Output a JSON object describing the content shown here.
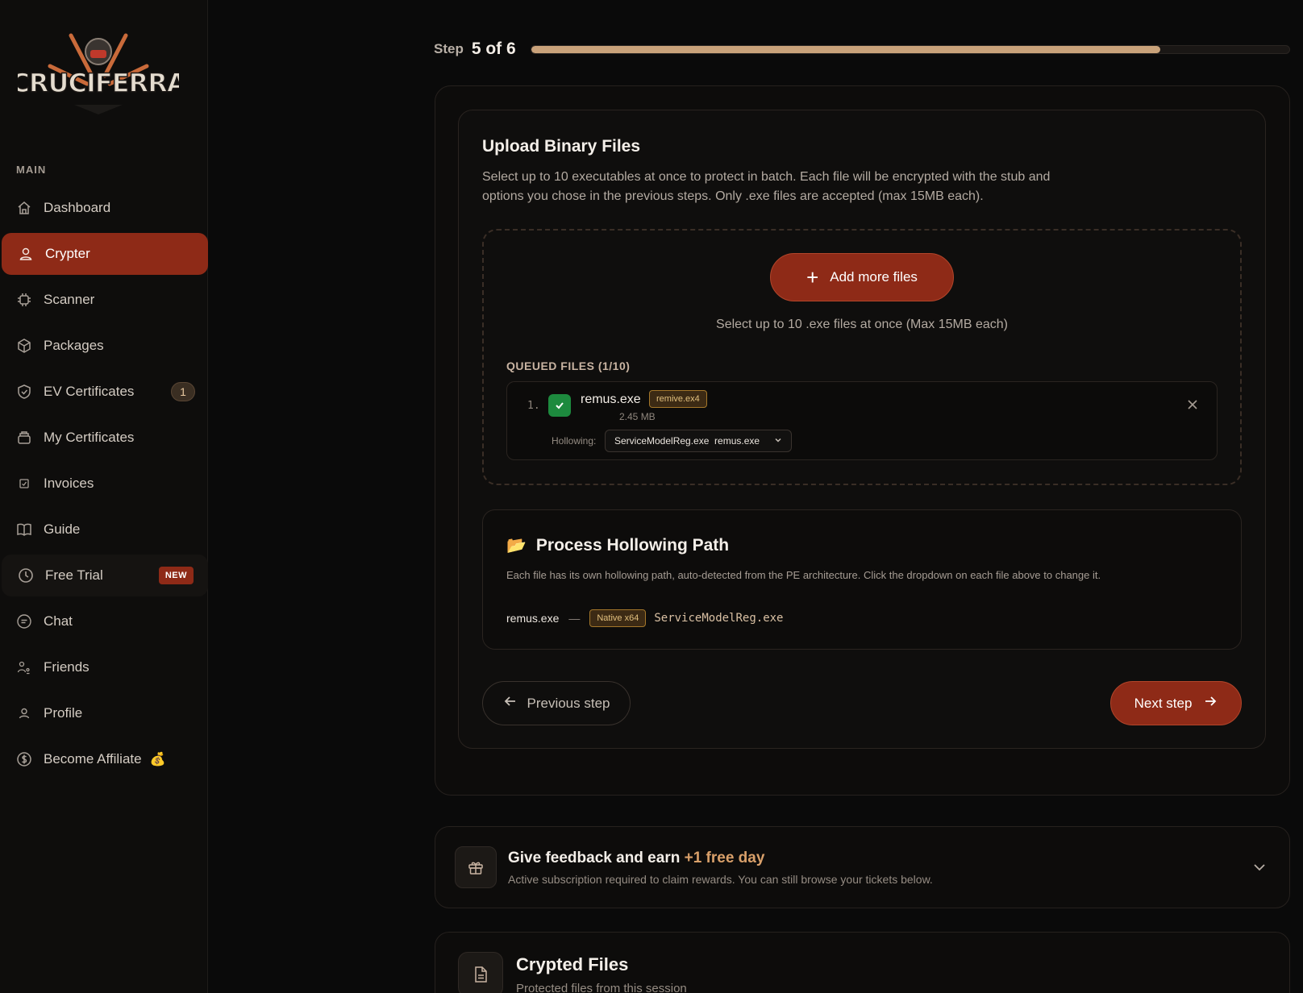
{
  "brand": {
    "logo_text": "CRUCIFERRA"
  },
  "sidebar": {
    "section_label": "MAIN",
    "items": [
      {
        "label": "Dashboard",
        "icon": "home-icon"
      },
      {
        "label": "Crypter",
        "icon": "user-icon",
        "active": true
      },
      {
        "label": "Scanner",
        "icon": "chip-icon"
      },
      {
        "label": "Packages",
        "icon": "box-icon"
      },
      {
        "label": "EV Certificates",
        "icon": "shield-icon",
        "badge": "1"
      },
      {
        "label": "My Certificates",
        "icon": "stack-icon"
      },
      {
        "label": "Invoices",
        "icon": "receipt-icon"
      },
      {
        "label": "Guide",
        "icon": "book-icon"
      },
      {
        "label": "Free Trial",
        "icon": "clock-icon",
        "badge": "NEW"
      },
      {
        "label": "Chat",
        "icon": "chat-icon"
      },
      {
        "label": "Friends",
        "icon": "friends-icon"
      },
      {
        "label": "Profile",
        "icon": "profile-icon"
      },
      {
        "label": "Become Affiliate",
        "icon": "dollar-icon",
        "emoji": "💰"
      }
    ]
  },
  "step": {
    "word": "Step",
    "value": "5 of 6",
    "progress": 0.83
  },
  "upload": {
    "title": "Upload Binary Files",
    "description": "Select up to 10 executables at once to protect in batch. Each file will be encrypted with the stub and options you chose in the previous steps. Only .exe files are accepted (max 15MB each).",
    "add_button": "Add more files",
    "hint": "Select up to 10 .exe files at once (Max 15MB each)",
    "queued_label": "QUEUED FILES (1/10)",
    "files": [
      {
        "index": "1.",
        "name": "remus.exe",
        "tag": "remive.ex4",
        "size": "2.45 MB",
        "hollowing_label": "Hollowing:",
        "hollowing_value": "ServiceModelReg.exe  remus.exe"
      }
    ]
  },
  "hollowing": {
    "emoji": "📂",
    "title": "Process Hollowing Path",
    "description": "Each file has its own hollowing path, auto-detected from the PE architecture. Click the dropdown on each file above to change it.",
    "file": "remus.exe",
    "separator": "—",
    "arch_tag": "Native x64",
    "path": "ServiceModelReg.exe"
  },
  "nav": {
    "prev": "Previous step",
    "next": "Next step"
  },
  "feedback": {
    "title": "Give feedback and earn",
    "title_accent": "+1 free day",
    "subtitle": "Active subscription required to claim rewards. You can still browse your tickets below."
  },
  "crypted": {
    "title": "Crypted Files",
    "subtitle": "Protected files from this session"
  },
  "colors": {
    "accent": "#8e2a17",
    "progress": "#c9a27a",
    "success": "#1d8a3e",
    "tag": "#a4772a"
  }
}
